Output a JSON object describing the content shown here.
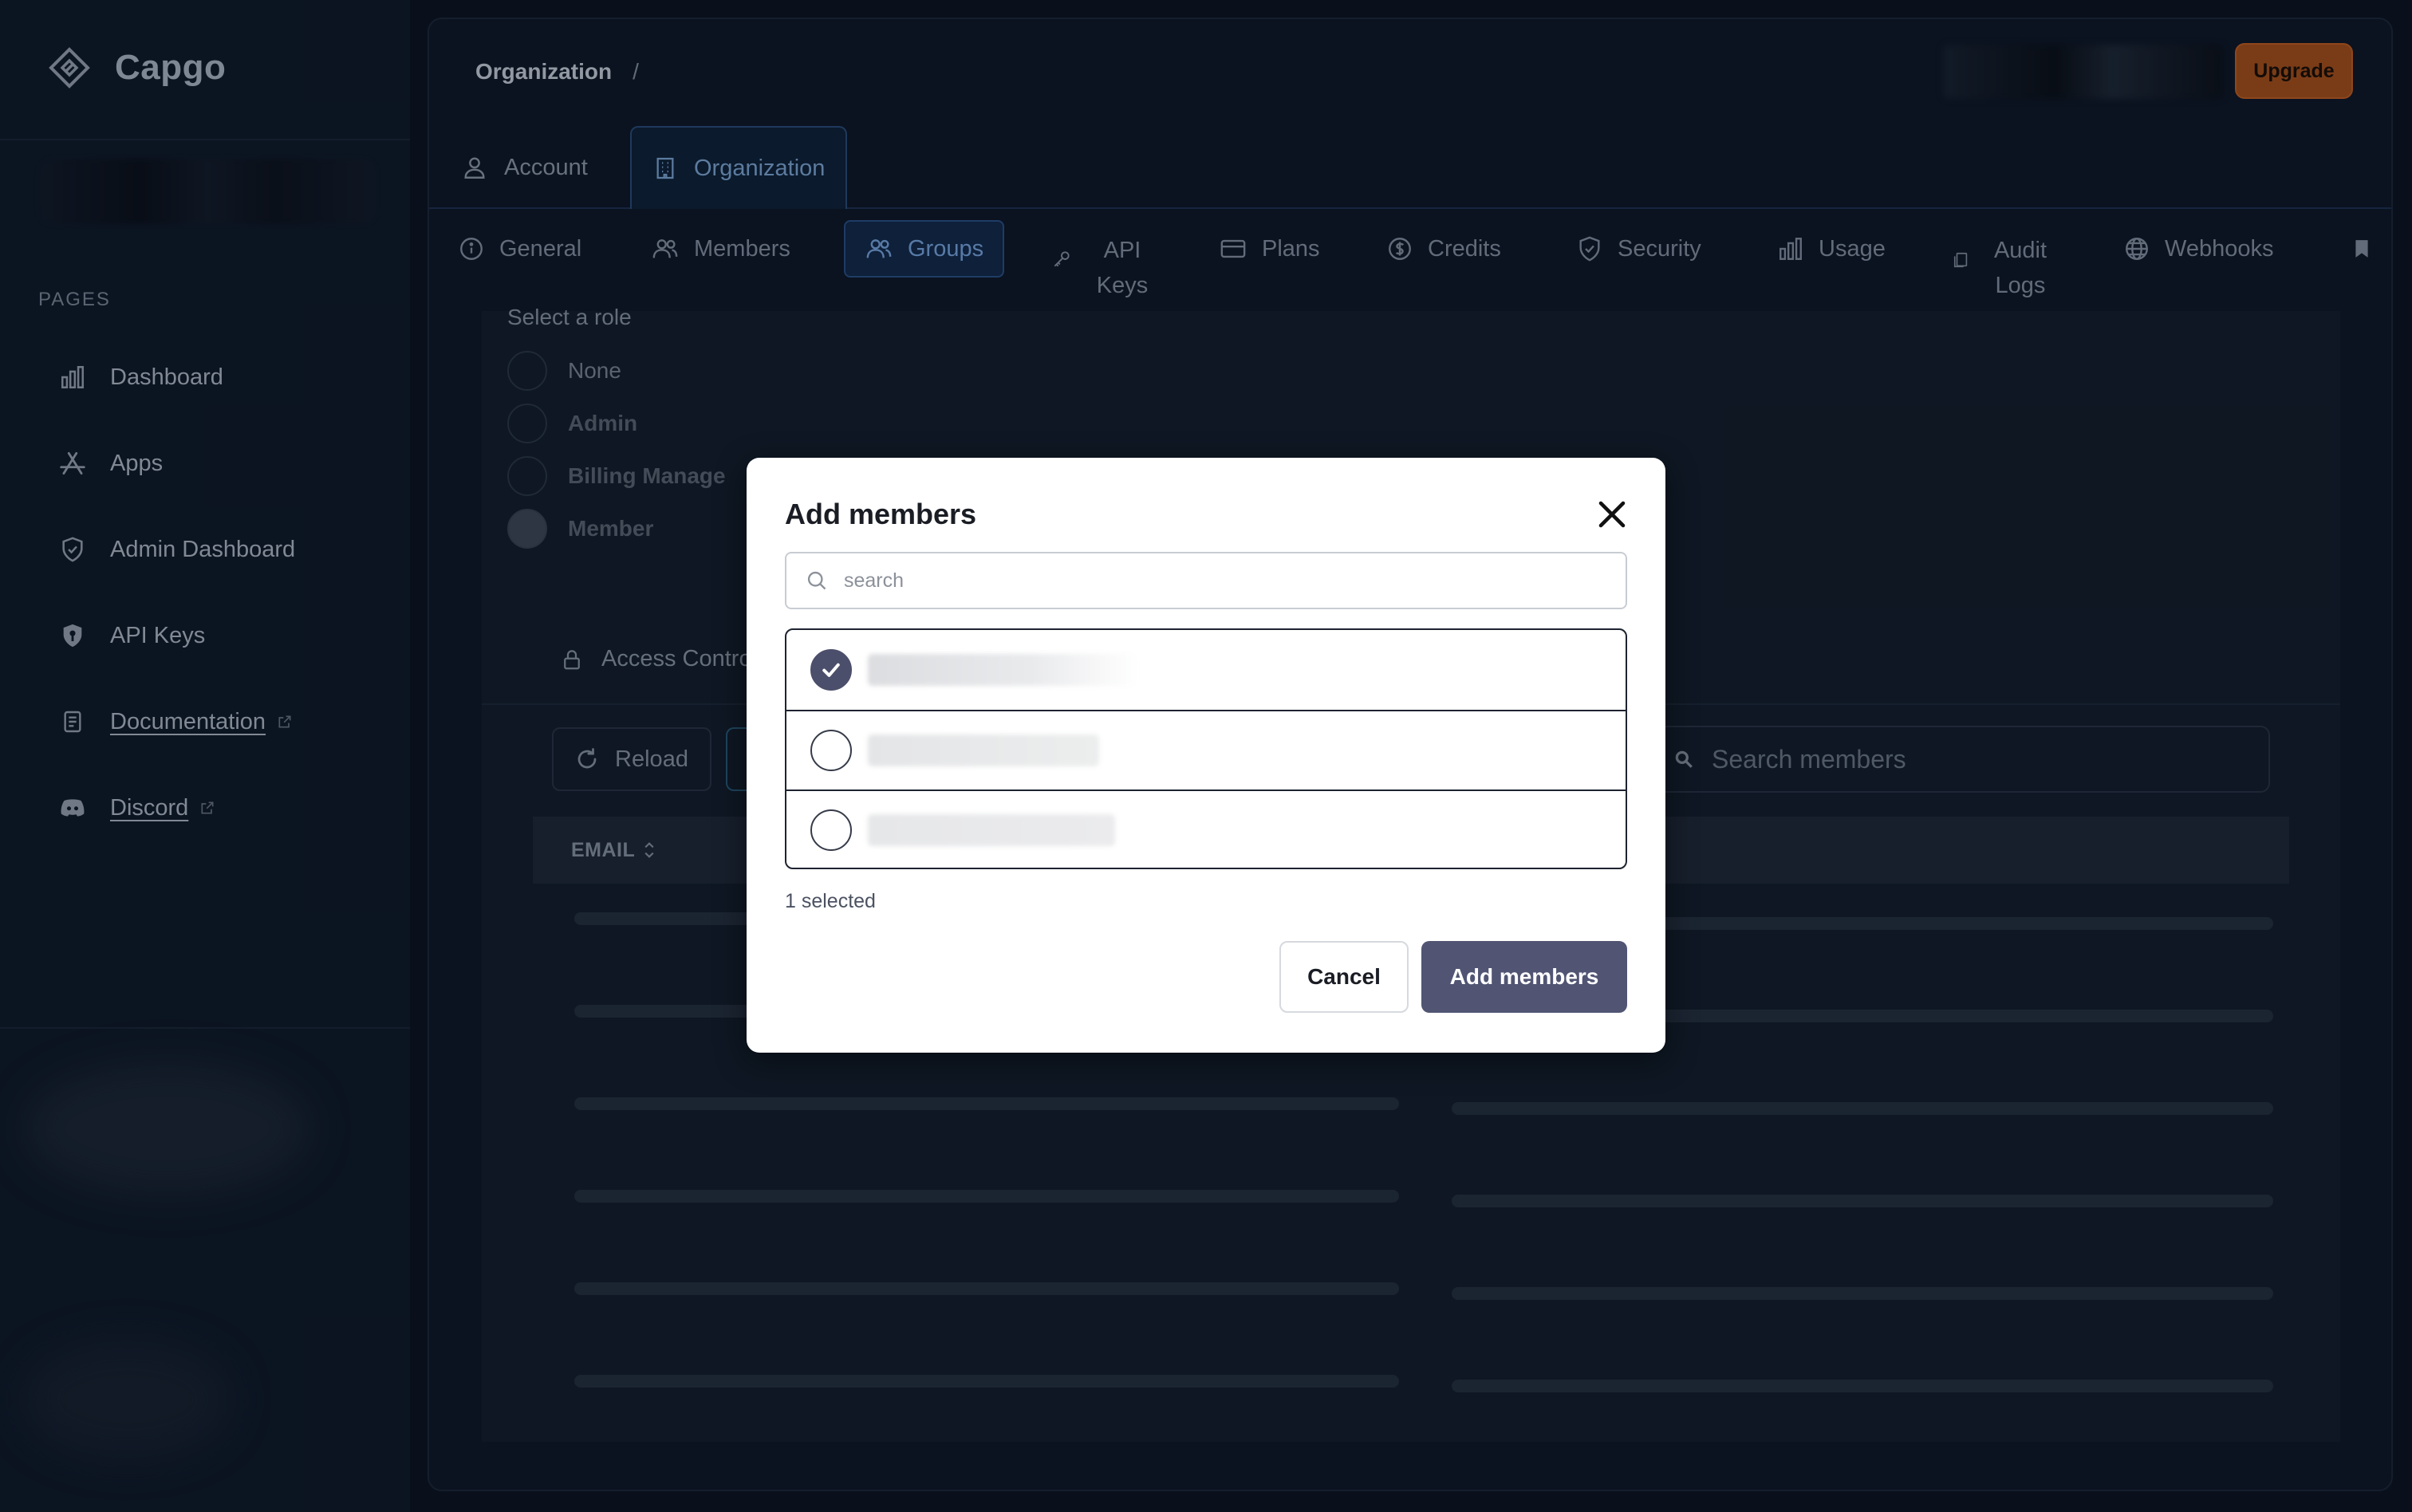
{
  "app": {
    "name": "Capgo"
  },
  "sidebar": {
    "section_label": "PAGES",
    "items": [
      {
        "label": "Dashboard",
        "icon": "bar-chart-icon"
      },
      {
        "label": "Apps",
        "icon": "app-store-icon"
      },
      {
        "label": "Admin Dashboard",
        "icon": "shield-check-icon"
      },
      {
        "label": "API Keys",
        "icon": "shield-key-icon"
      },
      {
        "label": "Documentation",
        "icon": "document-icon",
        "external": true
      },
      {
        "label": "Discord",
        "icon": "discord-icon",
        "external": true
      }
    ]
  },
  "header": {
    "breadcrumb": {
      "root": "Organization",
      "separator": "/"
    },
    "upgrade_label": "Upgrade",
    "upgrade_color": "#a8501a"
  },
  "top_tabs": [
    {
      "label": "Account",
      "icon": "user-icon",
      "active": false
    },
    {
      "label": "Organization",
      "icon": "building-icon",
      "active": true
    }
  ],
  "sub_tabs": [
    {
      "label": "General",
      "icon": "info-icon"
    },
    {
      "label": "Members",
      "icon": "users-icon"
    },
    {
      "label": "Groups",
      "icon": "users-group-icon",
      "active": true
    },
    {
      "label": "API Keys",
      "icon": "key-icon"
    },
    {
      "label": "Plans",
      "icon": "credit-card-icon"
    },
    {
      "label": "Credits",
      "icon": "dollar-circle-icon"
    },
    {
      "label": "Security",
      "icon": "shield-icon"
    },
    {
      "label": "Usage",
      "icon": "bar-chart-icon"
    },
    {
      "label": "Audit Logs",
      "icon": "log-icon"
    },
    {
      "label": "Webhooks",
      "icon": "globe-icon"
    }
  ],
  "role_section": {
    "label": "Select a role",
    "options": [
      {
        "label": "None",
        "selected": false
      },
      {
        "label": "Admin",
        "selected": false
      },
      {
        "label": "Billing Manage",
        "selected": false
      },
      {
        "label": "Member",
        "selected": true
      }
    ]
  },
  "access_control": {
    "label": "Access Contro"
  },
  "table": {
    "reload_label": "Reload",
    "search_placeholder": "Search members",
    "columns": [
      {
        "label": "EMAIL",
        "sortable": true
      }
    ]
  },
  "modal": {
    "title": "Add members",
    "search_placeholder": "search",
    "members": [
      {
        "checked": true
      },
      {
        "checked": false
      },
      {
        "checked": false
      }
    ],
    "selected_text": "1 selected",
    "cancel_label": "Cancel",
    "submit_label": "Add members",
    "submit_color": "#515573"
  }
}
